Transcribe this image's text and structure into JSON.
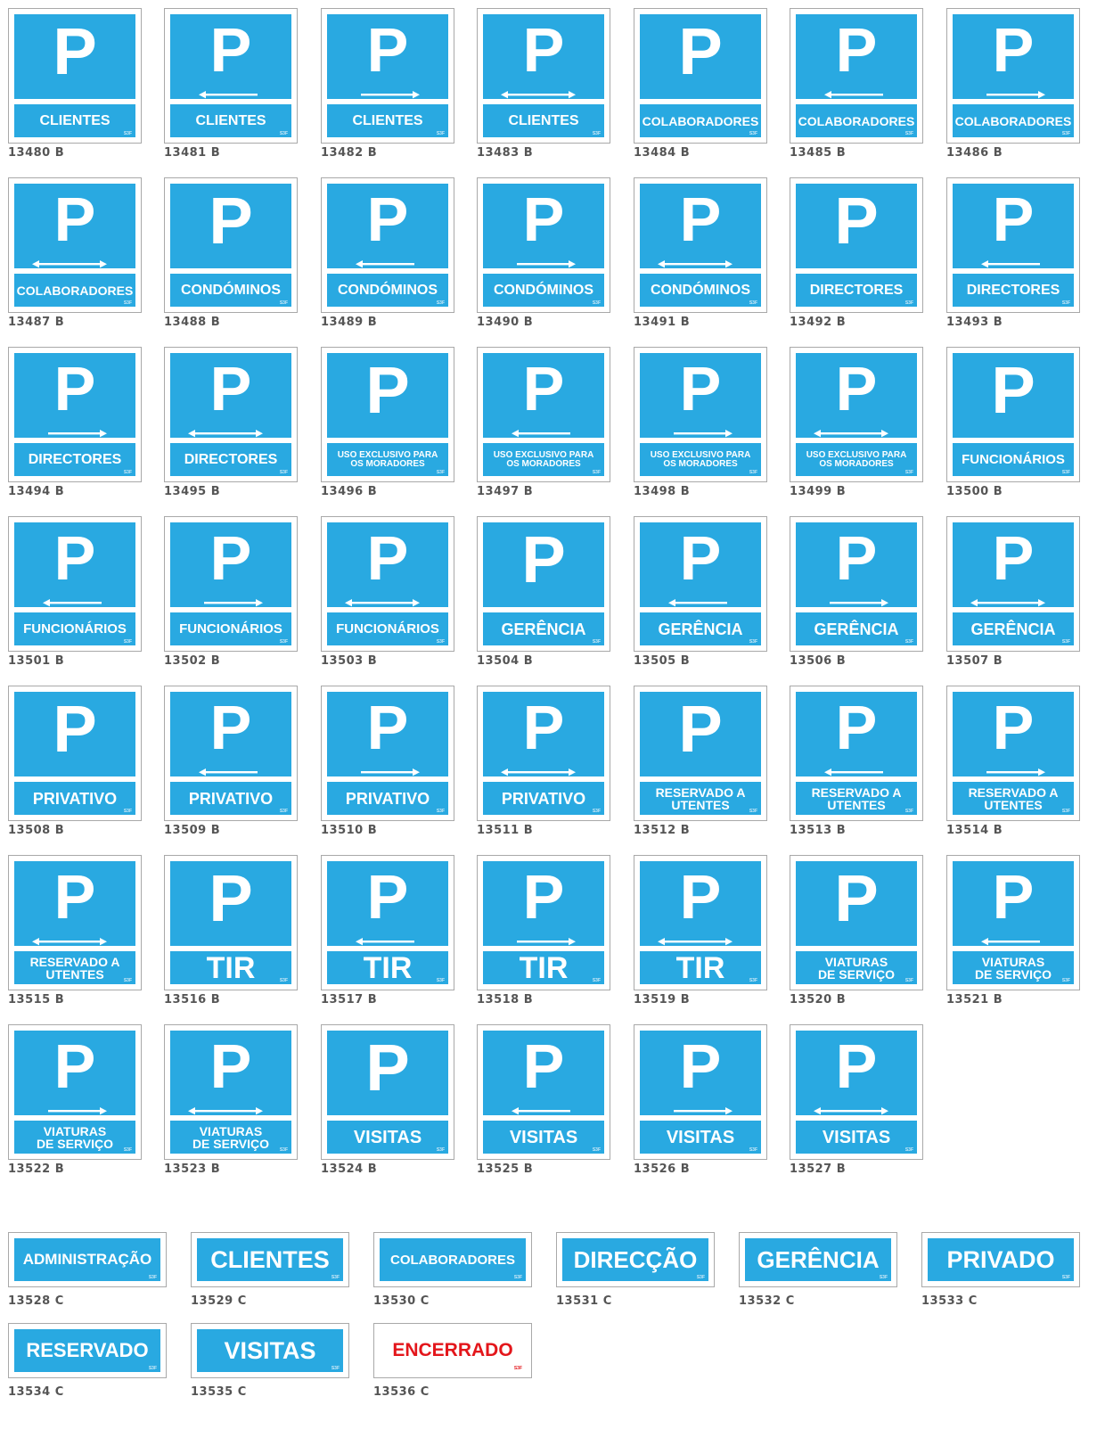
{
  "colors": {
    "sign_blue": "#29a9e1",
    "text_white": "#ffffff",
    "code_gray": "#555555",
    "closed_red": "#e3161b"
  },
  "logo_text": "S3F",
  "signs": [
    {
      "code": "13480 B",
      "label": "CLIENTES",
      "arrow": "none"
    },
    {
      "code": "13481 B",
      "label": "CLIENTES",
      "arrow": "left"
    },
    {
      "code": "13482 B",
      "label": "CLIENTES",
      "arrow": "right"
    },
    {
      "code": "13483 B",
      "label": "CLIENTES",
      "arrow": "both"
    },
    {
      "code": "13484 B",
      "label": "COLABORADORES",
      "arrow": "none"
    },
    {
      "code": "13485 B",
      "label": "COLABORADORES",
      "arrow": "left"
    },
    {
      "code": "13486 B",
      "label": "COLABORADORES",
      "arrow": "right"
    },
    {
      "code": "13487 B",
      "label": "COLABORADORES",
      "arrow": "both"
    },
    {
      "code": "13488 B",
      "label": "CONDÓMINOS",
      "arrow": "none"
    },
    {
      "code": "13489 B",
      "label": "CONDÓMINOS",
      "arrow": "left"
    },
    {
      "code": "13490 B",
      "label": "CONDÓMINOS",
      "arrow": "right"
    },
    {
      "code": "13491 B",
      "label": "CONDÓMINOS",
      "arrow": "both"
    },
    {
      "code": "13492 B",
      "label": "DIRECTORES",
      "arrow": "none"
    },
    {
      "code": "13493 B",
      "label": "DIRECTORES",
      "arrow": "left"
    },
    {
      "code": "13494 B",
      "label": "DIRECTORES",
      "arrow": "right"
    },
    {
      "code": "13495 B",
      "label": "DIRECTORES",
      "arrow": "both"
    },
    {
      "code": "13496 B",
      "label": "USO EXCLUSIVO PARA\nOS MORADORES",
      "arrow": "none"
    },
    {
      "code": "13497 B",
      "label": "USO EXCLUSIVO PARA\nOS MORADORES",
      "arrow": "left"
    },
    {
      "code": "13498 B",
      "label": "USO EXCLUSIVO PARA\nOS MORADORES",
      "arrow": "right"
    },
    {
      "code": "13499 B",
      "label": "USO EXCLUSIVO PARA\nOS MORADORES",
      "arrow": "both"
    },
    {
      "code": "13500 B",
      "label": "FUNCIONÁRIOS",
      "arrow": "none"
    },
    {
      "code": "13501 B",
      "label": "FUNCIONÁRIOS",
      "arrow": "left"
    },
    {
      "code": "13502 B",
      "label": "FUNCIONÁRIOS",
      "arrow": "right"
    },
    {
      "code": "13503 B",
      "label": "FUNCIONÁRIOS",
      "arrow": "both"
    },
    {
      "code": "13504 B",
      "label": "GERÊNCIA",
      "arrow": "none"
    },
    {
      "code": "13505 B",
      "label": "GERÊNCIA",
      "arrow": "left"
    },
    {
      "code": "13506 B",
      "label": "GERÊNCIA",
      "arrow": "right"
    },
    {
      "code": "13507 B",
      "label": "GERÊNCIA",
      "arrow": "both"
    },
    {
      "code": "13508 B",
      "label": "PRIVATIVO",
      "arrow": "none"
    },
    {
      "code": "13509 B",
      "label": "PRIVATIVO",
      "arrow": "left"
    },
    {
      "code": "13510 B",
      "label": "PRIVATIVO",
      "arrow": "right"
    },
    {
      "code": "13511 B",
      "label": "PRIVATIVO",
      "arrow": "both"
    },
    {
      "code": "13512 B",
      "label": "RESERVADO A\nUTENTES",
      "arrow": "none"
    },
    {
      "code": "13513 B",
      "label": "RESERVADO A\nUTENTES",
      "arrow": "left"
    },
    {
      "code": "13514 B",
      "label": "RESERVADO A\nUTENTES",
      "arrow": "right"
    },
    {
      "code": "13515 B",
      "label": "RESERVADO A\nUTENTES",
      "arrow": "both"
    },
    {
      "code": "13516 B",
      "label": "TIR",
      "arrow": "none"
    },
    {
      "code": "13517 B",
      "label": "TIR",
      "arrow": "left"
    },
    {
      "code": "13518 B",
      "label": "TIR",
      "arrow": "right"
    },
    {
      "code": "13519 B",
      "label": "TIR",
      "arrow": "both"
    },
    {
      "code": "13520 B",
      "label": "VIATURAS\nDE SERVIÇO",
      "arrow": "none"
    },
    {
      "code": "13521 B",
      "label": "VIATURAS\nDE SERVIÇO",
      "arrow": "left"
    },
    {
      "code": "13522 B",
      "label": "VIATURAS\nDE SERVIÇO",
      "arrow": "right"
    },
    {
      "code": "13523 B",
      "label": "VIATURAS\nDE SERVIÇO",
      "arrow": "both"
    },
    {
      "code": "13524 B",
      "label": "VISITAS",
      "arrow": "none"
    },
    {
      "code": "13525 B",
      "label": "VISITAS",
      "arrow": "left"
    },
    {
      "code": "13526 B",
      "label": "VISITAS",
      "arrow": "right"
    },
    {
      "code": "13527 B",
      "label": "VISITAS",
      "arrow": "both"
    }
  ],
  "plates": [
    {
      "code": "13528 C",
      "label": "ADMINISTRAÇÃO",
      "style": "blue"
    },
    {
      "code": "13529 C",
      "label": "CLIENTES",
      "style": "blue"
    },
    {
      "code": "13530 C",
      "label": "COLABORADORES",
      "style": "blue"
    },
    {
      "code": "13531 C",
      "label": "DIRECÇÃO",
      "style": "blue"
    },
    {
      "code": "13532 C",
      "label": "GERÊNCIA",
      "style": "blue"
    },
    {
      "code": "13533 C",
      "label": "PRIVADO",
      "style": "blue"
    },
    {
      "code": "13534 C",
      "label": "RESERVADO",
      "style": "blue"
    },
    {
      "code": "13535 C",
      "label": "VISITAS",
      "style": "blue"
    },
    {
      "code": "13536 C",
      "label": "ENCERRADO",
      "style": "red"
    }
  ]
}
